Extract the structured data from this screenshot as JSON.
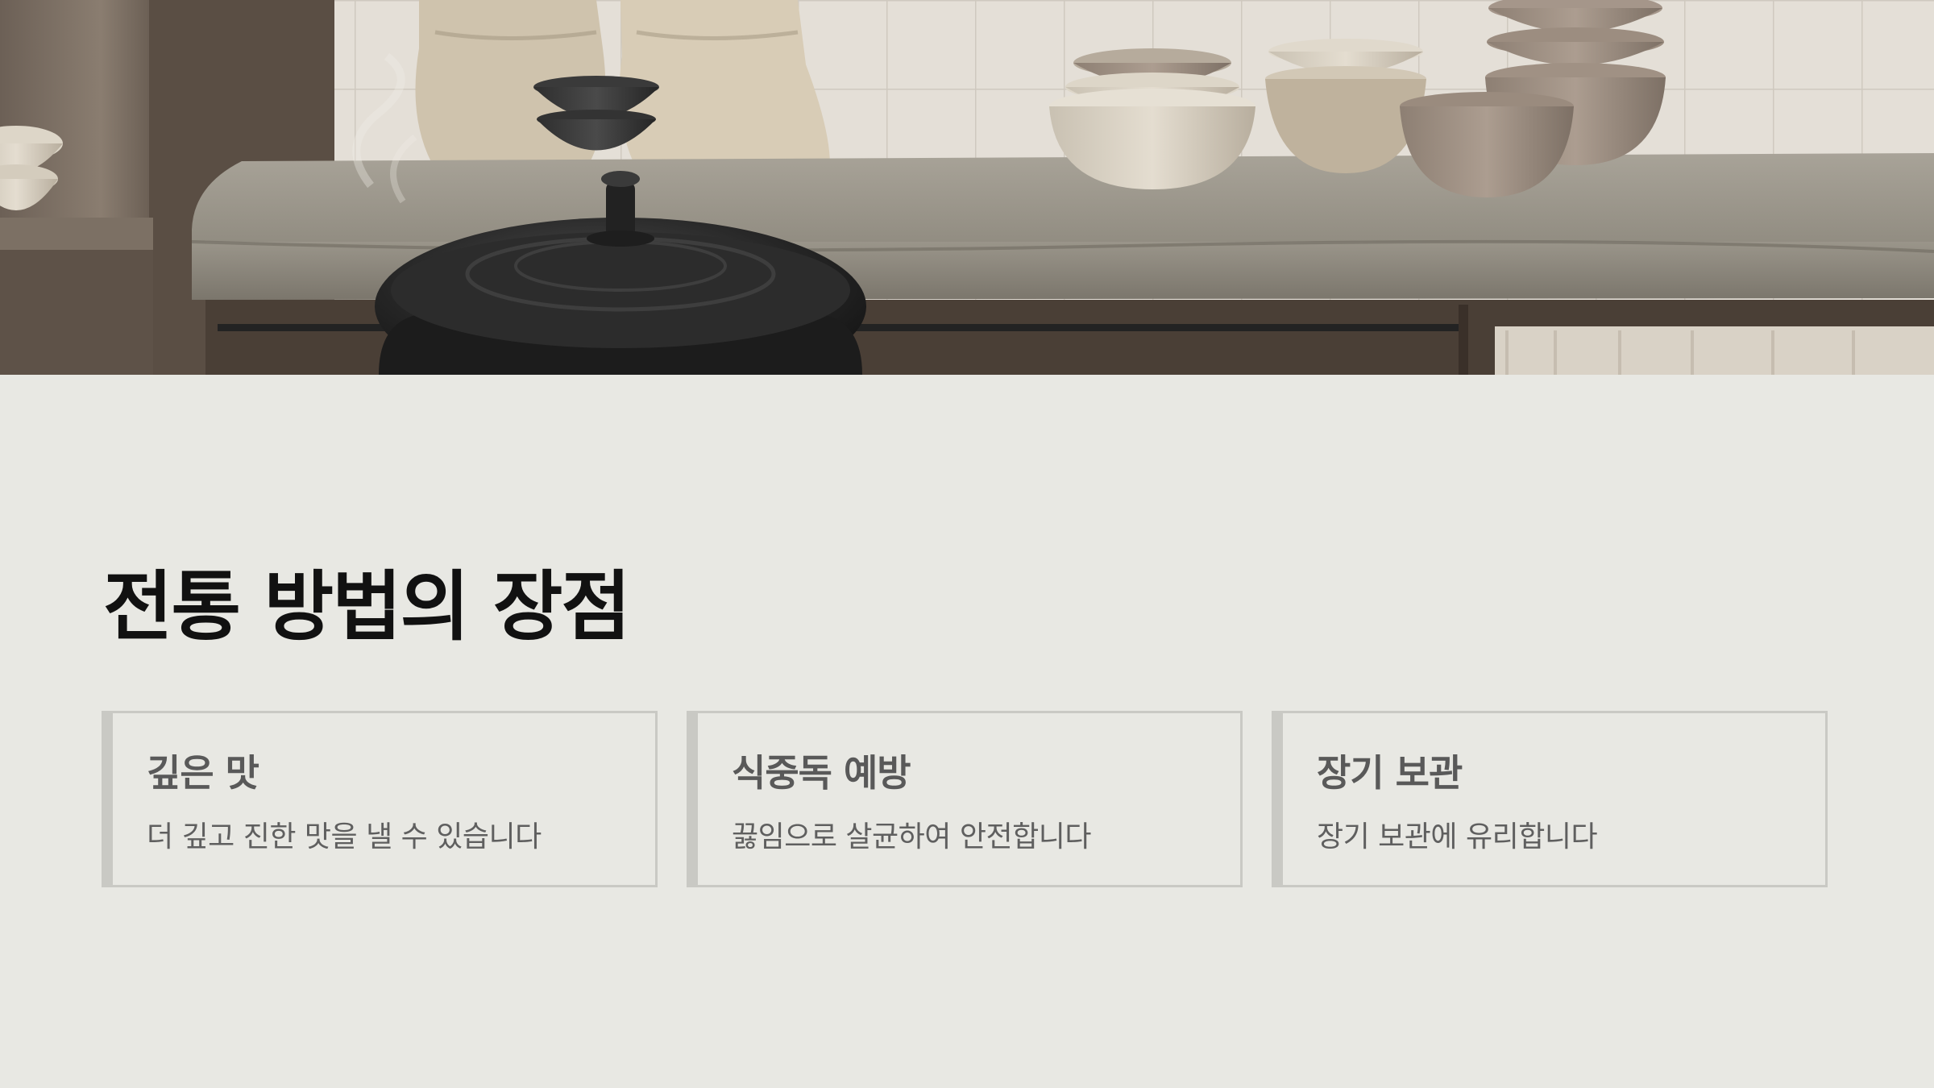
{
  "slide": {
    "title": "전통 방법의 장점",
    "hero_image": {
      "alt": "",
      "colors": {
        "tile_wall": "#e4dfd7",
        "stone_counter": "#9b968c",
        "iron_pot": "#262626",
        "ceramic_light": "#ddd6c8",
        "ceramic_taupe": "#a5968a",
        "wood": "#4a3f36"
      }
    },
    "cards": [
      {
        "title": "깊은 맛",
        "description": "더 깊고 진한 맛을 낼 수 있습니다"
      },
      {
        "title": "식중독 예방",
        "description": "끓임으로 살균하여 안전합니다"
      },
      {
        "title": "장기 보관",
        "description": "장기 보관에 유리합니다"
      }
    ],
    "colors": {
      "background": "#e8e8e3",
      "card_border": "#c9c9c4",
      "title_text": "#111111",
      "card_text": "#5f5f5f"
    }
  }
}
